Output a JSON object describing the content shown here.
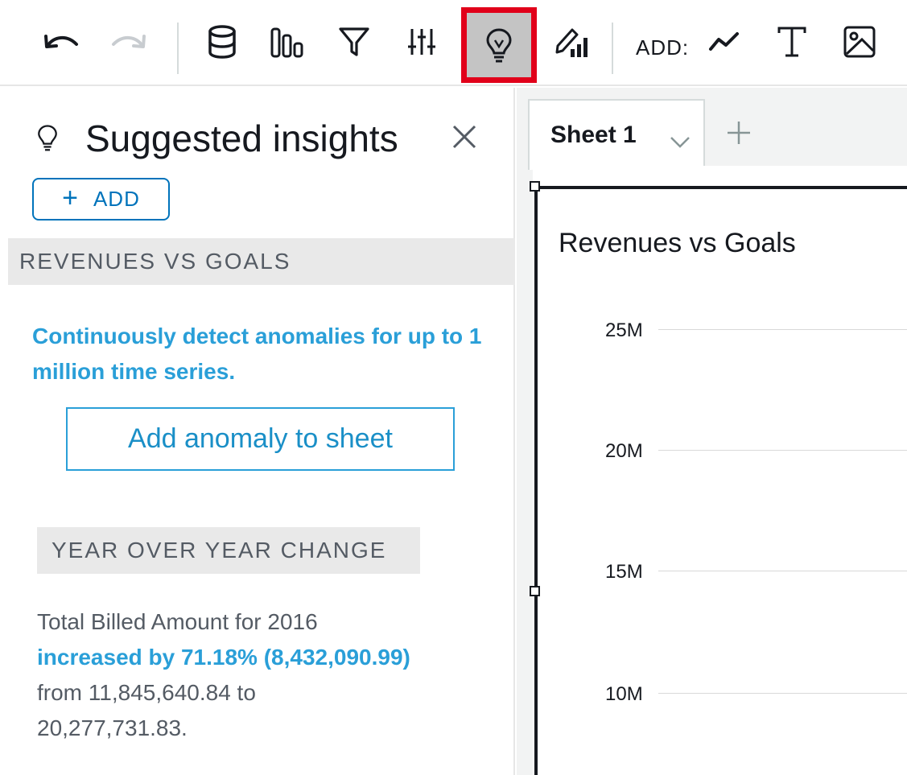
{
  "toolbar": {
    "buttons": [
      {
        "name": "undo-button",
        "icon": "undo-icon"
      },
      {
        "name": "redo-button",
        "icon": "redo-icon"
      },
      {
        "name": "dataset-button",
        "icon": "database-icon"
      },
      {
        "name": "visualize-button",
        "icon": "bar-chart-icon"
      },
      {
        "name": "filter-button",
        "icon": "filter-icon"
      },
      {
        "name": "parameters-button",
        "icon": "sliders-icon"
      },
      {
        "name": "insights-button",
        "icon": "lightbulb-icon",
        "selected": true
      },
      {
        "name": "format-visual-button",
        "icon": "pencil-chart-icon"
      }
    ],
    "add_label": "ADD:",
    "add_buttons": [
      {
        "name": "add-visual-button",
        "icon": "line-chart-icon"
      },
      {
        "name": "add-text-button",
        "icon": "text-icon"
      },
      {
        "name": "add-image-button",
        "icon": "image-icon"
      }
    ],
    "highlight_color": "#e1001a"
  },
  "panel": {
    "title": "Suggested insights",
    "add_label": "ADD",
    "insights": [
      {
        "header": "REVENUES VS GOALS",
        "text": "Continuously detect anomalies for up to 1 million time series.",
        "button": "Add anomaly to sheet"
      },
      {
        "header": "YEAR OVER YEAR CHANGE",
        "line1": "Total Billed Amount for 2016",
        "highlight": "increased by 71.18% (8,432,090.99)",
        "line2": "from 11,845,640.84 to",
        "line3": "20,277,731.83."
      }
    ]
  },
  "sheet": {
    "tab_label": "Sheet 1",
    "visual_title": "Revenues vs Goals",
    "y_ticks": [
      "25M",
      "20M",
      "15M",
      "10M"
    ]
  },
  "colors": {
    "accent_blue": "#2a9fd8",
    "button_blue": "#0073bb",
    "selected_bg": "#c4c4c4"
  }
}
